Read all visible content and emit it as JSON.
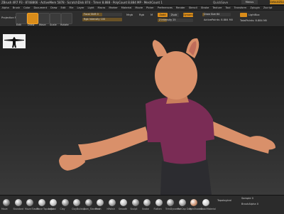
{
  "window": {
    "title": "ZBrush 4R7 P3 · 8748866 · ActiveMem 5878 · ScratchDisk 874 · Timer 8.888 · PolyCount 8.884 MP · MeshCount 1",
    "quicksave": "QuickSave",
    "menus_label": "Menus",
    "default_label": "DefaultZScript"
  },
  "menu": [
    "Alpha",
    "Brush",
    "Color",
    "Document",
    "Draw",
    "Edit",
    "File",
    "Layer",
    "Light",
    "Macro",
    "Marker",
    "Material",
    "Movie",
    "Picker",
    "Preferences",
    "Render",
    "Stencil",
    "Stroke",
    "Texture",
    "Tool",
    "Transform",
    "Zplugin",
    "Zscript"
  ],
  "toolbar": {
    "edit_label": "Edit",
    "draw_label": "Draw",
    "move_label": "Move",
    "scale_label": "Scale",
    "rotate_label": "Rotate",
    "rgb_label": "Rgb",
    "mrgb_label": "Mrgb",
    "m_label": "M",
    "zadd_label": "Zadd",
    "zsub_label": "Zsub",
    "zcut_label": "Zcut",
    "focal_shift": "Focal Shift 0",
    "draw_size": "Draw Size 64",
    "z_intensity": "Z Intensity 25",
    "rgb_intensity": "Rgb Intensity 100",
    "dynamic_label": "Dynamic",
    "active_points": "ActivePoints: 8.884 Mil",
    "total_points": "TotalPoints: 8.884 Mil",
    "projection_master": "Projection Master",
    "lightbox": "LightBox",
    "focal_shift_value": 0,
    "draw_size_value": 64,
    "z_intensity_value": 25,
    "rgb_intensity_value": 100
  },
  "viewport": {
    "colors": {
      "skin": "#d9906a",
      "shirt": "#7a2c55",
      "pants": "#2c2c30",
      "ear_inner": "#c06d5a"
    }
  },
  "bottom_shelf": {
    "items": [
      "Move",
      "Standard",
      "Move Elastic",
      "Move Topological",
      "Inflat",
      "Clay",
      "ClayBuildup",
      "Dam_Standard",
      "Pinch",
      "hPolish",
      "Smooth",
      "Sculpt",
      "Snake",
      "Flatten",
      "TrimDynamic",
      "MatCap Gray",
      "SkinShade4",
      "BasicMaterial"
    ],
    "topological": "Topological",
    "sample_label": "Sample 0",
    "active_brush": "BrushAlpha 0",
    "stroke_label": "Stroke",
    "tool_label": "Tool"
  }
}
